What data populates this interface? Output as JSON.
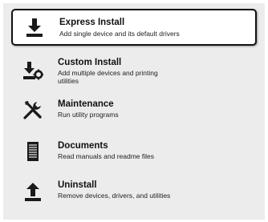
{
  "menu": {
    "items": [
      {
        "id": "express",
        "title": "Express Install",
        "description": "Add single device and its default drivers",
        "icon": "download-icon",
        "selected": true
      },
      {
        "id": "custom",
        "title": "Custom Install",
        "description": "Add multiple devices and printing utilities",
        "icon": "download-settings-icon",
        "selected": false
      },
      {
        "id": "maintenance",
        "title": "Maintenance",
        "description": "Run utility programs",
        "icon": "tools-icon",
        "selected": false
      },
      {
        "id": "documents",
        "title": "Documents",
        "description": "Read manuals and readme files",
        "icon": "document-icon",
        "selected": false
      },
      {
        "id": "uninstall",
        "title": "Uninstall",
        "description": "Remove devices, drivers, and utilities",
        "icon": "upload-icon",
        "selected": false
      }
    ]
  },
  "colors": {
    "panel_background": "#ececec",
    "selected_background": "#ffffff",
    "selected_border": "#111111",
    "icon": "#1a1a1a"
  }
}
